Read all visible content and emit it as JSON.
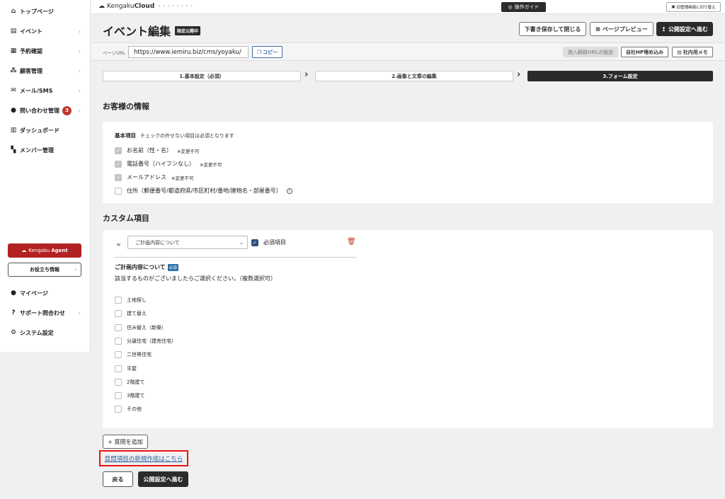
{
  "sidebar": {
    "items": [
      {
        "label": "トップページ",
        "icon": "home-icon",
        "glyph": "⌂",
        "chevron": false
      },
      {
        "label": "イベント",
        "icon": "document-icon",
        "glyph": "▤",
        "chevron": true
      },
      {
        "label": "予約確認",
        "icon": "calendar-icon",
        "glyph": "▦",
        "chevron": true
      },
      {
        "label": "顧客管理",
        "icon": "users-icon",
        "glyph": "⁂",
        "chevron": true
      },
      {
        "label": "メール/SMS",
        "icon": "mail-icon",
        "glyph": "✉",
        "chevron": true
      },
      {
        "label": "問い合わせ管理",
        "icon": "chat-icon",
        "glyph": "●",
        "chevron": true,
        "badge": "3"
      },
      {
        "label": "ダッシュボード",
        "icon": "chart-icon",
        "glyph": "▥",
        "chevron": false
      },
      {
        "label": "メンバー管理",
        "icon": "grid-icon",
        "glyph": "▚",
        "chevron": false
      }
    ],
    "agent": {
      "prefix": "Kengaku",
      "name": "Agent"
    },
    "info_button": "お役立ち情報",
    "bottom_items": [
      {
        "label": "マイページ",
        "icon": "person-icon",
        "glyph": "●",
        "chevron": false
      },
      {
        "label": "サポート問合わせ",
        "icon": "help-icon",
        "glyph": "?",
        "chevron": true
      },
      {
        "label": "システム設定",
        "icon": "gear-icon",
        "glyph": "⚙",
        "chevron": false
      }
    ]
  },
  "topbar": {
    "logo_prefix": "Kengaku",
    "logo_name": "Cloud",
    "logo_dots": "• • • • • • • •",
    "guide_button": "操作ガイド",
    "switch_button": "旧管理画面に切り替え"
  },
  "header": {
    "title": "イベント編集",
    "status": "限定公開中",
    "buttons": {
      "save_close": "下書き保存して閉じる",
      "preview": "ページプレビュー",
      "publish": "公開設定へ進む"
    }
  },
  "url_row": {
    "label": "ページURL",
    "value": "https://www.iemiru.biz/cms/yoyaku/",
    "copy": "コピー",
    "inflow": "流入経路URLの設定",
    "embed": "自社HP埋め込み",
    "memo": "社内用メモ"
  },
  "steps": [
    "1.基本設定（必須）",
    "2.画像と文章の編集",
    "3.フォーム設定"
  ],
  "customer": {
    "section_title": "お客様の情報",
    "basic_title": "基本項目",
    "basic_note": "チェックの外せない項目は必須となります",
    "fields": [
      {
        "label": "お名前（性・名）",
        "note": "※変更不可",
        "checked": true
      },
      {
        "label": "電話番号（ハイフンなし）",
        "note": "※変更不可",
        "checked": true
      },
      {
        "label": "メールアドレス",
        "note": "※変更不可",
        "checked": true
      },
      {
        "label": "住所（郵便番号/都道府県/市区町村/番地/建物名・部屋番号）",
        "note": "",
        "checked": false
      }
    ]
  },
  "custom": {
    "section_title": "カスタム項目",
    "selected_item": "ご計画内容について",
    "required_label": "必須項目",
    "question_title": "ご計画内容について",
    "required_tag": "必須",
    "question_desc": "該当するものがございましたらご選択ください。（複数選択可）",
    "options": [
      "土地探し",
      "建て替え",
      "住み替え（新築）",
      "分譲住宅（建売住宅）",
      "二世帯住宅",
      "平屋",
      "2階建て",
      "3階建て",
      "その他"
    ]
  },
  "footer": {
    "add_question": "+ 質問を追加",
    "new_link": "質問項目の新規作成はこちら",
    "back": "戻る",
    "next": "公開設定へ進む"
  }
}
